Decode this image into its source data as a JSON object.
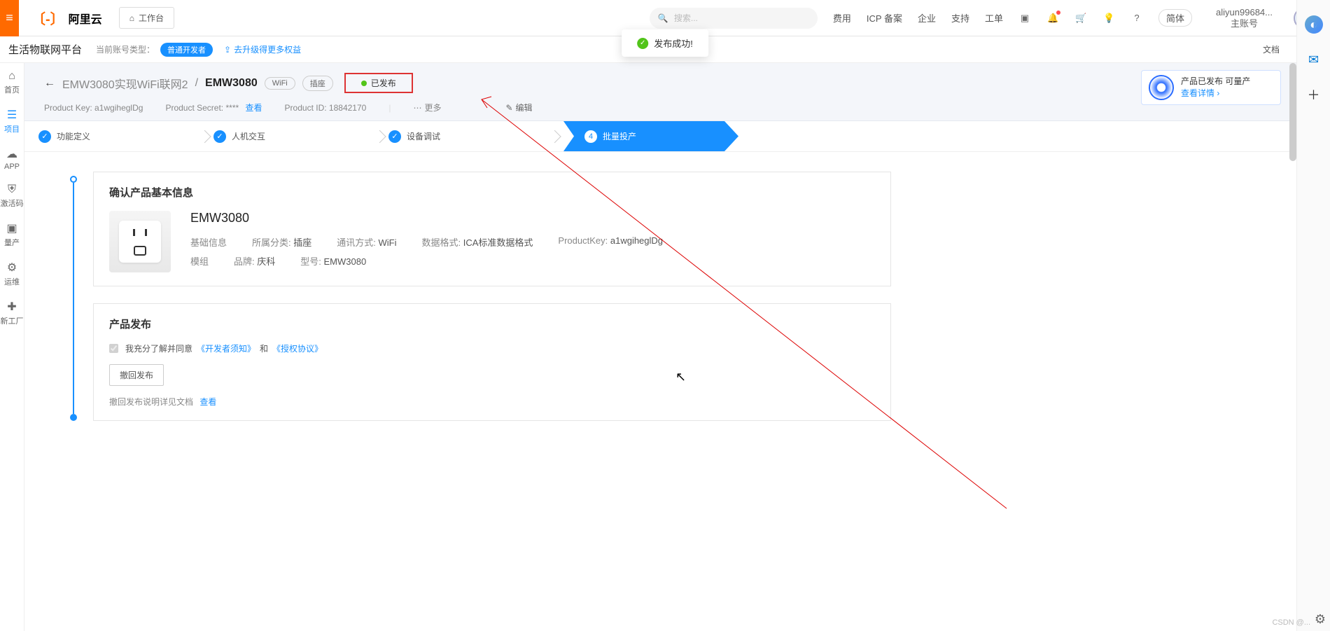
{
  "topBar": {
    "logoText": "阿里云",
    "workspace": "工作台",
    "searchPlaceholder": "搜索...",
    "links": {
      "cost": "费用",
      "icp": "ICP 备案",
      "enterprise": "企业",
      "support": "支持",
      "ticket": "工单"
    },
    "lang": "简体",
    "account": "aliyun99684...",
    "accountSub": "主账号"
  },
  "subHeader": {
    "platform": "生活物联网平台",
    "acctTypeLabel": "当前账号类型：",
    "acctTypeValue": "普通开发者",
    "upgrade": "去升级得更多权益",
    "doc": "文档"
  },
  "leftNav": [
    {
      "key": "home",
      "label": "首页",
      "icon": "⌂"
    },
    {
      "key": "project",
      "label": "项目",
      "icon": "☰",
      "active": true
    },
    {
      "key": "app",
      "label": "APP",
      "icon": "☁"
    },
    {
      "key": "code",
      "label": "激活码",
      "icon": "⛨"
    },
    {
      "key": "mass",
      "label": "量产",
      "icon": "▣"
    },
    {
      "key": "ops",
      "label": "运维",
      "icon": "⚙"
    },
    {
      "key": "nf",
      "label": "新工厂",
      "icon": "✚"
    }
  ],
  "product": {
    "back": "←",
    "parent": "EMW3080实现WiFi联网2",
    "name": "EMW3080",
    "tags": [
      "WiFi",
      "插座"
    ],
    "status": "已发布",
    "pkLabel": "Product Key:",
    "pkValue": "a1wgiheglDg",
    "psLabel": "Product Secret:",
    "psValue": "****",
    "viewLink": "查看",
    "pidLabel": "Product ID:",
    "pidValue": "18842170",
    "more": "更多",
    "edit": "编辑",
    "massCard": {
      "line1": "产品已发布 可量产",
      "line2": "查看详情"
    }
  },
  "steps": [
    {
      "label": "功能定义",
      "done": true
    },
    {
      "label": "人机交互",
      "done": true
    },
    {
      "label": "设备调试",
      "done": true
    },
    {
      "label": "批量投产",
      "num": "4",
      "active": true
    }
  ],
  "card1": {
    "title": "确认产品基本信息",
    "name": "EMW3080",
    "rows": [
      [
        {
          "lbl": "基础信息",
          "val": ""
        },
        {
          "lbl": "所属分类:",
          "val": "插座"
        },
        {
          "lbl": "通讯方式:",
          "val": "WiFi"
        },
        {
          "lbl": "数据格式:",
          "val": "ICA标准数据格式"
        },
        {
          "lbl": "ProductKey:",
          "val": "a1wgiheglDg"
        }
      ],
      [
        {
          "lbl": "模组",
          "val": ""
        },
        {
          "lbl": "品牌:",
          "val": "庆科"
        },
        {
          "lbl": "型号:",
          "val": "EMW3080"
        }
      ]
    ]
  },
  "card2": {
    "title": "产品发布",
    "agreePrefix": "我充分了解并同意",
    "link1": "《开发者须知》",
    "agreeMid": "和",
    "link2": "《授权协议》",
    "revokeBtn": "撤回发布",
    "docNote": "撤回发布说明详见文档",
    "docLink": "查看"
  },
  "toast": "发布成功!",
  "watermark": "CSDN @..."
}
